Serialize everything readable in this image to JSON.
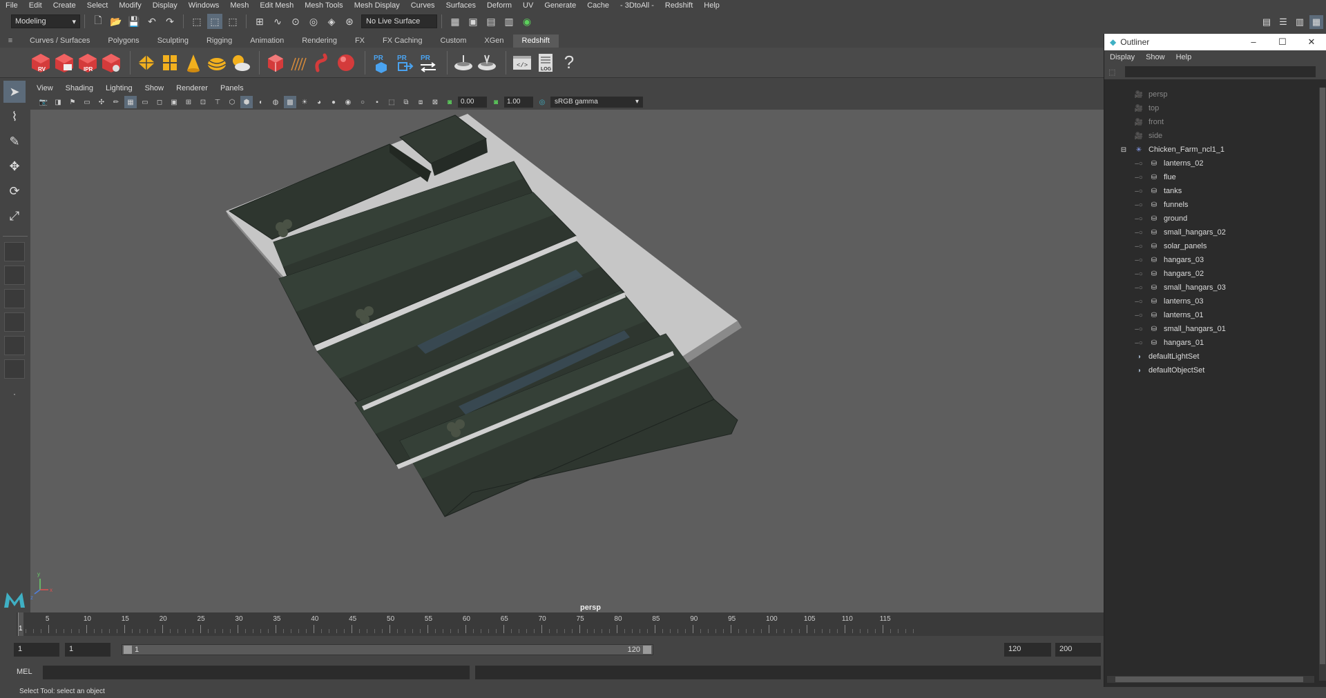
{
  "menubar": [
    "File",
    "Edit",
    "Create",
    "Select",
    "Modify",
    "Display",
    "Windows",
    "Mesh",
    "Edit Mesh",
    "Mesh Tools",
    "Mesh Display",
    "Curves",
    "Surfaces",
    "Deform",
    "UV",
    "Generate",
    "Cache",
    "- 3DtoAll -",
    "Redshift",
    "Help"
  ],
  "statusline": {
    "mode": "Modeling",
    "live_surface": "No Live Surface"
  },
  "shelf_tabs": [
    "Curves / Surfaces",
    "Polygons",
    "Sculpting",
    "Rigging",
    "Animation",
    "Rendering",
    "FX",
    "FX Caching",
    "Custom",
    "XGen",
    "Redshift"
  ],
  "shelf_active": "Redshift",
  "shelf_icons": {
    "rv_label": "RV",
    "ipr_label": "IPR",
    "pr_label": "PR",
    "log_label": "LOG",
    "code_label": "</>",
    "help_label": "?"
  },
  "panel_menu": [
    "View",
    "Shading",
    "Lighting",
    "Show",
    "Renderer",
    "Panels"
  ],
  "panel_toolbar": {
    "exposure": "0.00",
    "gamma_value": "1.00",
    "color_space": "sRGB gamma"
  },
  "viewport": {
    "camera": "persp",
    "axis_x": "x",
    "axis_y": "y",
    "axis_z": "z"
  },
  "timeline": {
    "current_frame": "1",
    "ticks": [
      "5",
      "10",
      "15",
      "20",
      "25",
      "30",
      "35",
      "40",
      "45",
      "50",
      "55",
      "60",
      "65",
      "70",
      "75",
      "80",
      "85",
      "90",
      "95",
      "100",
      "105",
      "110",
      "115"
    ]
  },
  "range": {
    "start": "1",
    "playback_start": "1",
    "slider_start": "1",
    "slider_end": "120",
    "playback_end": "120",
    "end": "200"
  },
  "cmdline": {
    "label": "MEL"
  },
  "helpline": "Select Tool: select an object",
  "outliner": {
    "title": "Outliner",
    "menu": [
      "Display",
      "Show",
      "Help"
    ],
    "cameras": [
      "persp",
      "top",
      "front",
      "side"
    ],
    "group": "Chicken_Farm_ncl1_1",
    "children": [
      "lanterns_02",
      "flue",
      "tanks",
      "funnels",
      "ground",
      "small_hangars_02",
      "solar_panels",
      "hangars_03",
      "hangars_02",
      "small_hangars_03",
      "lanterns_03",
      "lanterns_01",
      "small_hangars_01",
      "hangars_01"
    ],
    "sets": [
      "defaultLightSet",
      "defaultObjectSet"
    ]
  },
  "colors": {
    "accent": "#5c6b7a",
    "viewport_bg": "#5e5e5e",
    "hangar_dark": "#2e362f",
    "ground_light": "#c6c6c6",
    "redshift_red": "#d43b3b"
  }
}
